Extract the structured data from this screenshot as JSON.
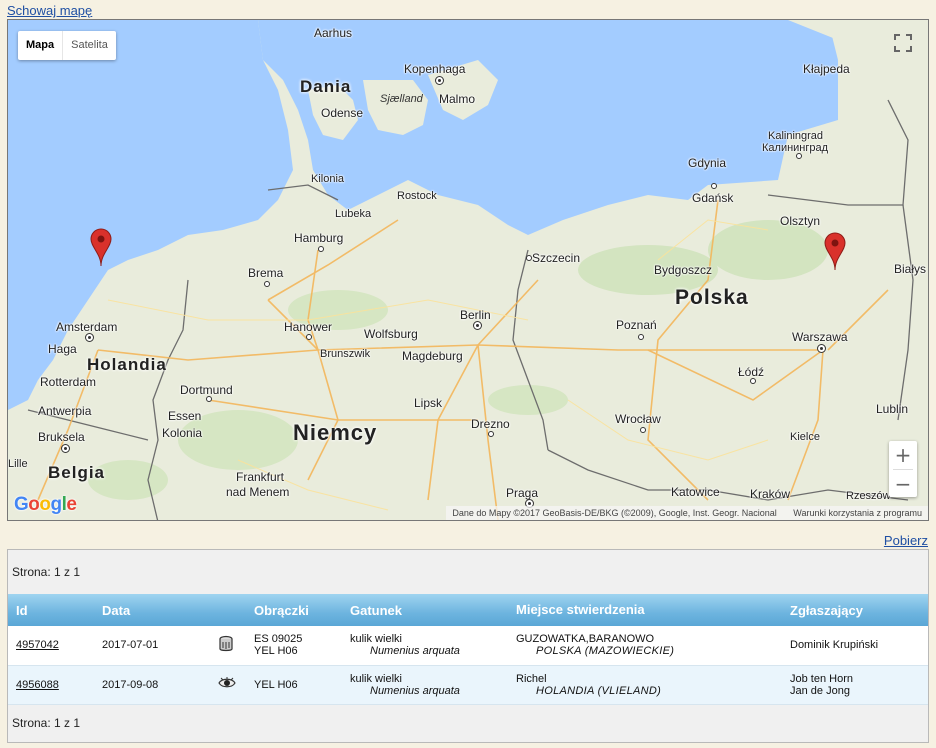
{
  "links": {
    "hide_map": "Schowaj mapę",
    "download": "Pobierz"
  },
  "map": {
    "types": [
      "Mapa",
      "Satelita"
    ],
    "zoom_in": "+",
    "zoom_out": "−",
    "google": "Google",
    "attribution": "Dane do Mapy ©2017 GeoBasis-DE/BKG (©2009), Google, Inst. Geogr. Nacional",
    "terms": "Warunki korzystania z programu",
    "countries": [
      "Dania",
      "Holandia",
      "Niemcy",
      "Polska",
      "Belgia"
    ],
    "cities": [
      "Aarhus",
      "Kopenhaga",
      "Malmo",
      "Odense",
      "Kłajpeda",
      "Kaliningrad",
      "Калининград",
      "Gdynia",
      "Gdańsk",
      "Olsztyn",
      "Kilonia",
      "Rostock",
      "Lubeka",
      "Hamburg",
      "Szczecin",
      "Bydgoszcz",
      "Białys",
      "Brema",
      "Amsterdam",
      "Haga",
      "Rotterdam",
      "Hanower",
      "Wolfsburg",
      "Berlin",
      "Brunszwik",
      "Magdeburg",
      "Poznań",
      "Warszawa",
      "Łódź",
      "Dortmund",
      "Essen",
      "Antwerpia",
      "Kolonia",
      "Bruksela",
      "Lipsk",
      "Drezno",
      "Wrocław",
      "Lublin",
      "Kielce",
      "Frankfurt",
      "nad Menem",
      "Praga",
      "Katowice",
      "Kraków",
      "Rzeszów",
      "Lille"
    ],
    "sea": "Sjælland",
    "markers": 2,
    "marker_color": "#d9312b"
  },
  "pagination": {
    "top": "Strona: 1 z 1",
    "bottom": "Strona: 1 z 1"
  },
  "table": {
    "headers": [
      "Id",
      "Data",
      "",
      "Obrączki",
      "Gatunek",
      "Miejsce stwierdzenia",
      "Zgłaszający"
    ],
    "rows": [
      {
        "id": "4957042",
        "date": "2017-07-01",
        "icon": "ring-icon",
        "rings": [
          "ES 09025",
          "YEL H06"
        ],
        "species": "kulik wielki",
        "latin": "Numenius arquata",
        "place": "GUZOWATKA,BARANOWO",
        "region": "POLSKA (MAZOWIECKIE)",
        "reporters": [
          "Dominik Krupiński"
        ]
      },
      {
        "id": "4956088",
        "date": "2017-09-08",
        "icon": "eye-icon",
        "rings": [
          "YEL H06"
        ],
        "species": "kulik wielki",
        "latin": "Numenius arquata",
        "place": "Richel",
        "region": "HOLANDIA (VLIELAND)",
        "reporters": [
          "Job ten Horn",
          "Jan de Jong"
        ]
      }
    ]
  },
  "colors": {
    "header_bg": "#6db4df",
    "link": "#1f4fa3",
    "sea": "#a3ccff",
    "land": "#e9ecdc"
  }
}
